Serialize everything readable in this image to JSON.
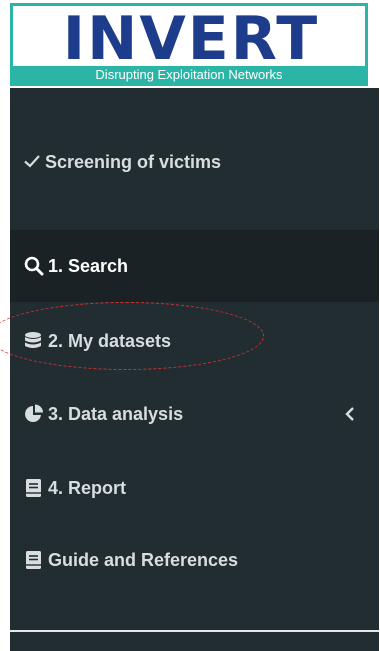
{
  "logo": {
    "wordmark": "INVERT",
    "tagline": "Disrupting Exploitation Networks",
    "brand_color": "#1d3d8c",
    "accent_color": "#2bb5a6"
  },
  "sidebar": {
    "header": {
      "label": "Screening of victims",
      "icon": "check-icon"
    },
    "items": [
      {
        "label": "1. Search",
        "icon": "search-icon",
        "active": true
      },
      {
        "label": "2. My datasets",
        "icon": "database-icon",
        "active": false
      },
      {
        "label": "3. Data analysis",
        "icon": "pie-chart-icon",
        "active": false,
        "has_submenu": true
      },
      {
        "label": "4. Report",
        "icon": "book-icon",
        "active": false
      },
      {
        "label": "Guide and References",
        "icon": "book-icon",
        "active": false
      }
    ],
    "bg_color": "#222d32",
    "active_bg_color": "#1a2226"
  },
  "annotation": {
    "color": "#d43030",
    "target": "2. My datasets"
  }
}
